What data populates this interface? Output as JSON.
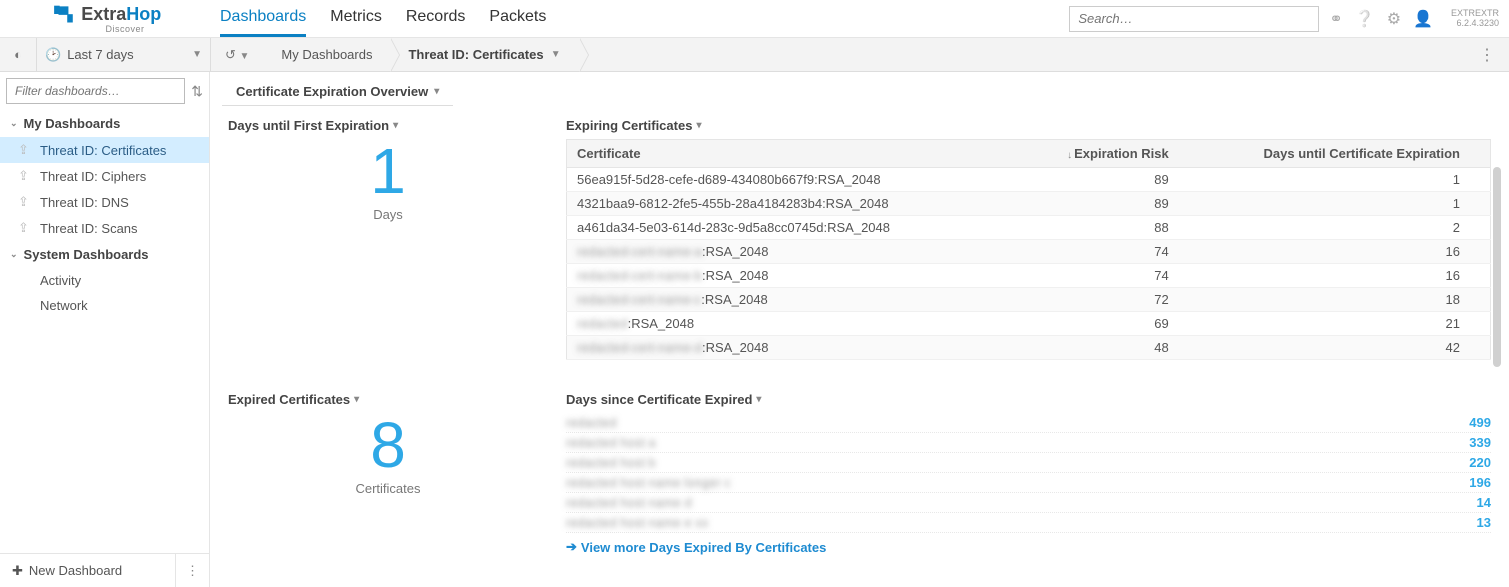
{
  "app": {
    "brand_a": "Extra",
    "brand_b": "Hop",
    "tagline": "Discover",
    "version_label": "EXTREXTR",
    "version_num": "6.2.4.3230",
    "search_placeholder": "Search…"
  },
  "nav": {
    "links": [
      "Dashboards",
      "Metrics",
      "Records",
      "Packets"
    ],
    "active_index": 0
  },
  "timebar": {
    "range_label": "Last 7 days"
  },
  "crumbs": {
    "a": "My Dashboards",
    "b": "Threat ID: Certificates"
  },
  "sidebar": {
    "filter_placeholder": "Filter dashboards…",
    "group1": "My Dashboards",
    "items1": [
      "Threat ID: Certificates",
      "Threat ID: Ciphers",
      "Threat ID: DNS",
      "Threat ID: Scans"
    ],
    "selected_index": 0,
    "group2": "System Dashboards",
    "items2": [
      "Activity",
      "Network"
    ],
    "new_dashboard": "New Dashboard"
  },
  "panel": {
    "tab_title": "Certificate Expiration Overview",
    "w1_title": "Days until First Expiration",
    "w1_value": "1",
    "w1_unit": "Days",
    "w2_title": "Expiring Certificates",
    "w2_cols": [
      "Certificate",
      "Expiration Risk",
      "Days until Certificate Expiration"
    ],
    "w2_rows": [
      {
        "c": "56ea915f-5d28-cefe-d689-434080b667f9:RSA_2048",
        "r": "89",
        "d": "1",
        "blur": false
      },
      {
        "c": "4321baa9-6812-2fe5-455b-28a4184283b4:RSA_2048",
        "r": "89",
        "d": "1",
        "blur": false
      },
      {
        "c": "a461da34-5e03-614d-283c-9d5a8cc0745d:RSA_2048",
        "r": "88",
        "d": "2",
        "blur": false
      },
      {
        "c": "redacted-cert-name-a:RSA_2048",
        "r": "74",
        "d": "16",
        "blur": true
      },
      {
        "c": "redacted-cert-name-b:RSA_2048",
        "r": "74",
        "d": "16",
        "blur": true
      },
      {
        "c": "redacted-cert-name-c:RSA_2048",
        "r": "72",
        "d": "18",
        "blur": true
      },
      {
        "c": "redacted:RSA_2048",
        "r": "69",
        "d": "21",
        "blur": true
      },
      {
        "c": "redacted-cert-name-d:RSA_2048",
        "r": "48",
        "d": "42",
        "blur": true
      }
    ],
    "w3_title": "Expired Certificates",
    "w3_value": "8",
    "w3_unit": "Certificates",
    "w4_title": "Days since Certificate Expired",
    "w4_rows": [
      {
        "n": "redacted",
        "v": "499"
      },
      {
        "n": "redacted host a",
        "v": "339"
      },
      {
        "n": "redacted host b",
        "v": "220"
      },
      {
        "n": "redacted host name longer c",
        "v": "196"
      },
      {
        "n": "redacted host name d",
        "v": "14"
      },
      {
        "n": "redacted host name e xx",
        "v": "13"
      }
    ],
    "w4_more": "View more Days Expired By Certificates"
  }
}
